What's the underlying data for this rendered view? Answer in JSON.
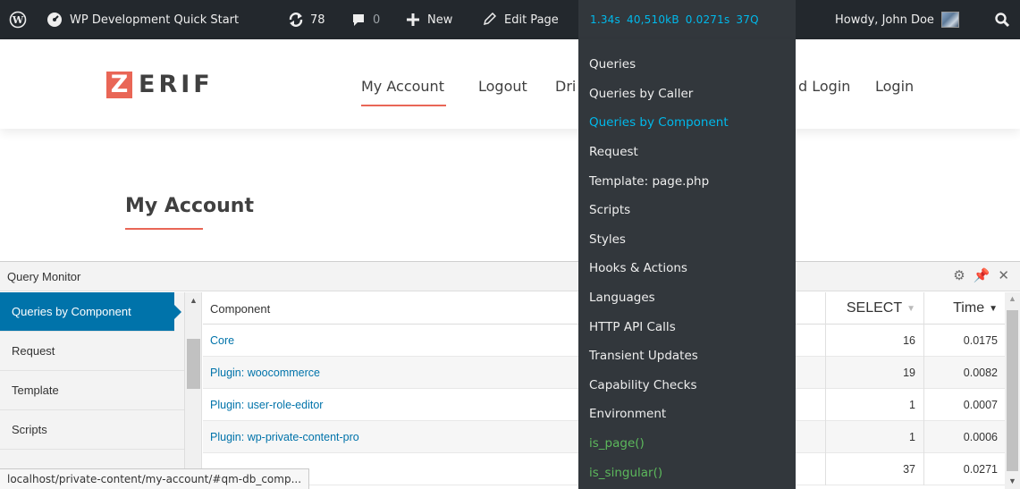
{
  "admin_bar": {
    "site_name": "WP Development Quick Start",
    "updates_count": "78",
    "comments_count": "0",
    "new_label": "New",
    "edit_label": "Edit Page",
    "qm_time": "1.34s",
    "qm_memory": "40,510kB",
    "qm_query_time": "0.0271s",
    "qm_query_count": "37Q",
    "greeting": "Howdy, John Doe"
  },
  "site": {
    "logo_letter": "Z",
    "logo_rest": "ERIF",
    "nav": [
      "My Account",
      "Logout",
      "Dri",
      "d Login",
      "Login"
    ]
  },
  "page": {
    "title": "My Account"
  },
  "query_monitor": {
    "title": "Query Monitor",
    "sidebar": [
      "Queries by Component",
      "Request",
      "Template",
      "Scripts"
    ],
    "table": {
      "headers": {
        "component": "Component",
        "select": "SELECT",
        "time": "Time"
      },
      "rows": [
        {
          "component": "Core",
          "select": "16",
          "time": "0.0175"
        },
        {
          "component": "Plugin: woocommerce",
          "select": "19",
          "time": "0.0082"
        },
        {
          "component": "Plugin: user-role-editor",
          "select": "1",
          "time": "0.0007"
        },
        {
          "component": "Plugin: wp-private-content-pro",
          "select": "1",
          "time": "0.0006"
        },
        {
          "component": "",
          "select": "37",
          "time": "0.0271"
        }
      ]
    }
  },
  "status_url": "localhost/private-content/my-account/#qm-db_comp...",
  "qm_menu": [
    "Queries",
    "Queries by Caller",
    "Queries by Component",
    "Request",
    "Template: page.php",
    "Scripts",
    "Styles",
    "Hooks & Actions",
    "Languages",
    "HTTP API Calls",
    "Transient Updates",
    "Capability Checks",
    "Environment",
    "is_page()",
    "is_singular()"
  ],
  "colors": {
    "admin_bar_bg": "#23282d",
    "qm_accent": "#00b9eb",
    "brand": "#e96656",
    "active_tab": "#0073aa",
    "condition_green": "#5cb85c"
  }
}
